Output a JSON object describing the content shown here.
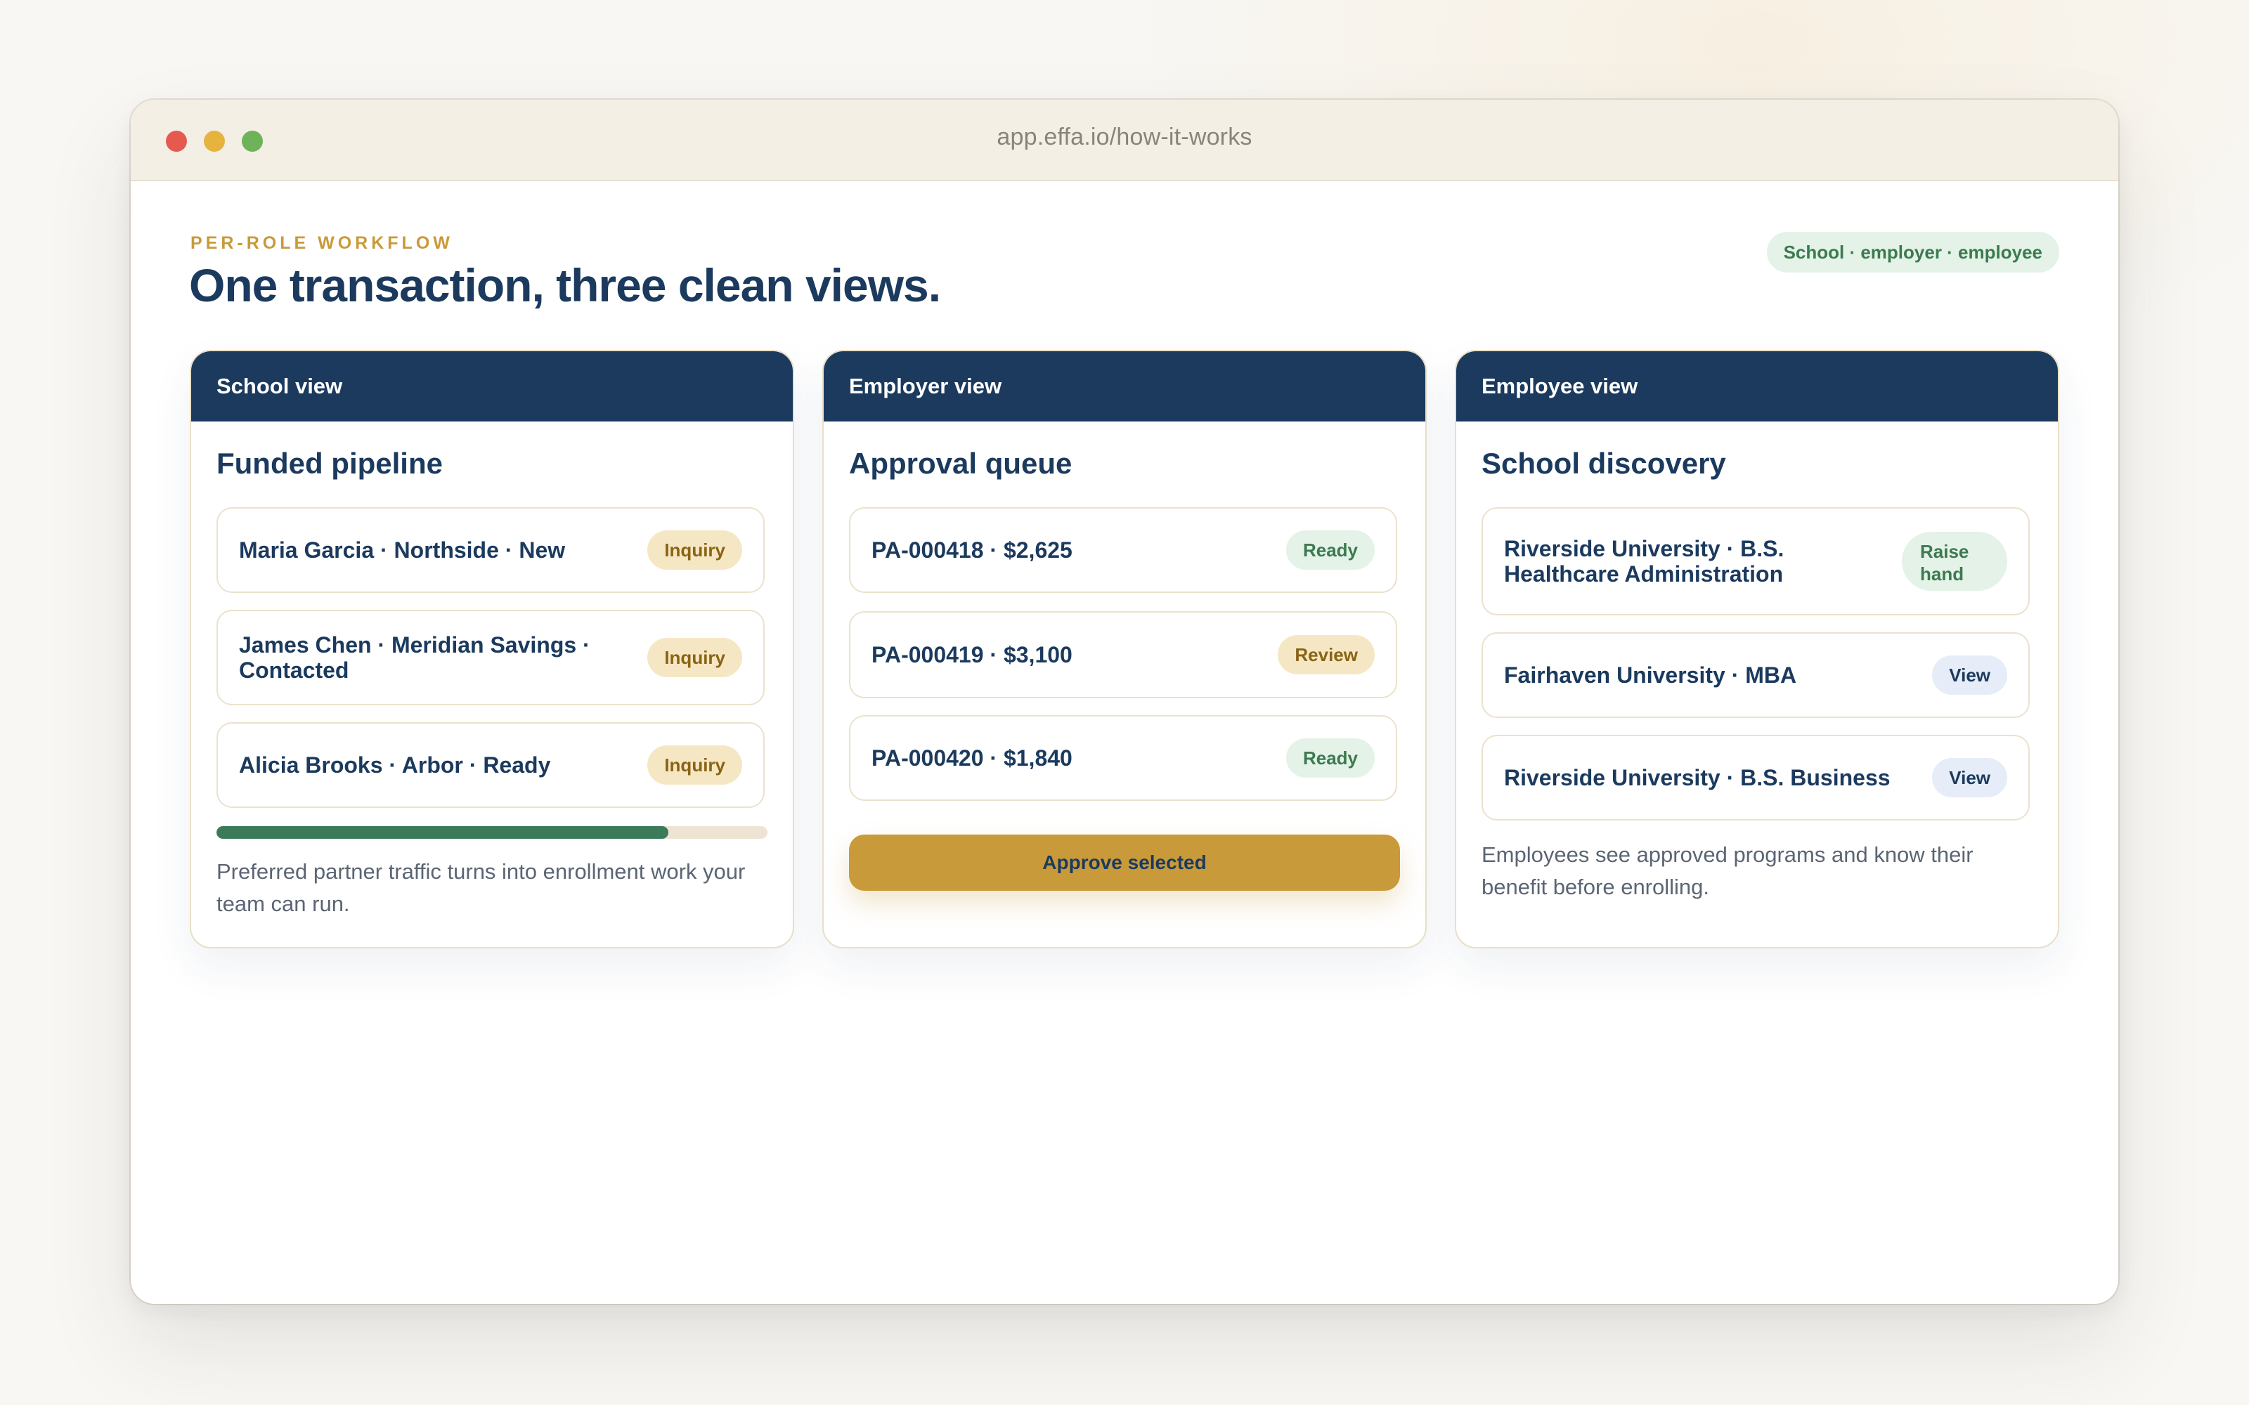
{
  "window": {
    "url": "app.effa.io/how-it-works"
  },
  "header": {
    "eyebrow": "PER-ROLE WORKFLOW",
    "headline": "One transaction, three clean views.",
    "roles_pill": "School · employer · employee"
  },
  "school_card": {
    "header": "School view",
    "title": "Funded pipeline",
    "rows": [
      {
        "text": "Maria Garcia · Northside · New",
        "badge": "Inquiry"
      },
      {
        "text": "James Chen · Meridian Savings · Contacted",
        "badge": "Inquiry"
      },
      {
        "text": "Alicia Brooks · Arbor · Ready",
        "badge": "Inquiry"
      }
    ],
    "progress": 0.82,
    "description": "Preferred partner traffic turns into enrollment work your team can run."
  },
  "employer_card": {
    "header": "Employer view",
    "title": "Approval queue",
    "rows": [
      {
        "text": "PA-000418 · $2,625",
        "badge": "Ready"
      },
      {
        "text": "PA-000419 · $3,100",
        "badge": "Review"
      },
      {
        "text": "PA-000420 · $1,840",
        "badge": "Ready"
      }
    ],
    "button": "Approve selected"
  },
  "employee_card": {
    "header": "Employee view",
    "title": "School discovery",
    "rows": [
      {
        "text": "Riverside University · B.S. Healthcare Administration",
        "badge": "Raise hand"
      },
      {
        "text": "Fairhaven University · MBA",
        "badge": "View"
      },
      {
        "text": "Riverside University · B.S. Business",
        "badge": "View"
      }
    ],
    "description": "Employees see approved programs and know their benefit before enrolling."
  },
  "colors": {
    "navy": "#1b3a5e",
    "gold": "#c99a3a",
    "green": "#3c7a5a",
    "badge_gold_bg": "#f6e7c4",
    "badge_green_bg": "#e4f2e8",
    "badge_blue_bg": "#e6edf8"
  }
}
